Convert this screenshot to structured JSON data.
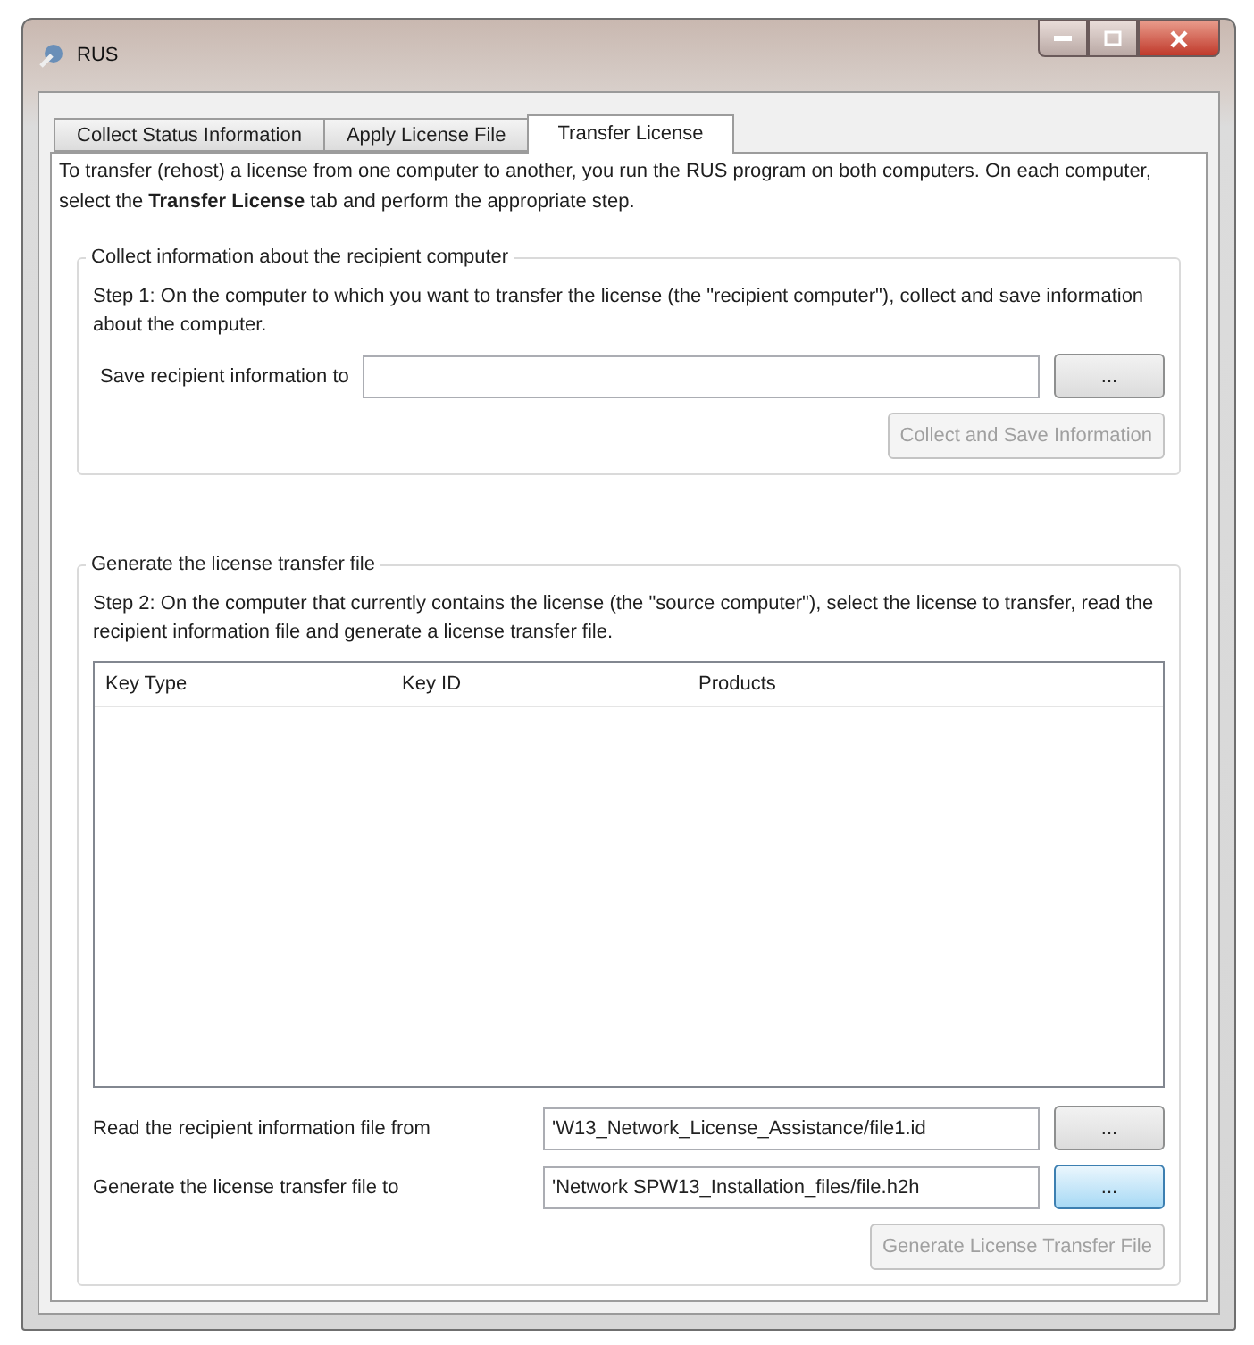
{
  "window": {
    "title": "RUS"
  },
  "tabs": [
    {
      "label": "Collect Status Information",
      "selected": false
    },
    {
      "label": "Apply License File",
      "selected": false
    },
    {
      "label": "Transfer License",
      "selected": true
    }
  ],
  "intro": "To transfer (rehost) a license from one computer to another, you run the RUS program on both computers. On each computer, select the **Transfer License** tab and perform the appropriate step.",
  "collect_group": {
    "legend": "Collect information about the recipient computer",
    "step": "Step 1: On the computer to which you want to transfer the license (the \"recipient computer\"), collect and save information about the computer.",
    "fields": [
      {
        "label": "Save recipient information to",
        "browse": "...",
        "focused": false
      }
    ],
    "action": {
      "label": "Collect and Save Information",
      "disabled": true
    }
  },
  "generate_group": {
    "legend": "Generate the license transfer file",
    "step": "Step 2: On the computer that currently contains the license (the \"source computer\"), select the license to transfer, read the recipient information file and generate a license transfer file.",
    "table": {
      "columns": [
        "Key Type",
        "Key ID",
        "Products"
      ]
    },
    "fields": [
      {
        "label": "Read the recipient information file from",
        "value": "'W13_Network_License_Assistance/file1.id",
        "browse": "...",
        "focused": false
      },
      {
        "label": "Generate the license transfer file to",
        "value": "'Network SPW13_Installation_files/file.h2h",
        "browse": "...",
        "focused": true
      }
    ],
    "action": {
      "label": "Generate License Transfer File",
      "disabled": true
    }
  }
}
